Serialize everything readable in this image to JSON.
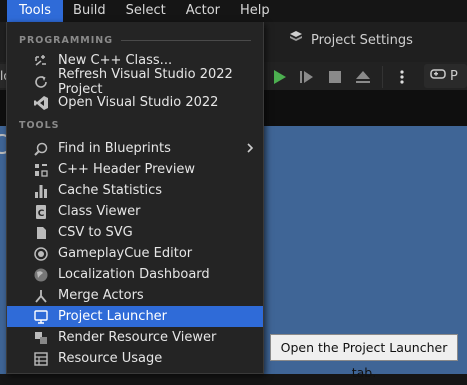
{
  "menubar": {
    "items": [
      {
        "label": "Tools",
        "active": true
      },
      {
        "label": "Build"
      },
      {
        "label": "Select"
      },
      {
        "label": "Actor"
      },
      {
        "label": "Help"
      }
    ]
  },
  "editor": {
    "project_settings_label": "Project Settings",
    "left_fragment": "lo",
    "right_fragment": "P"
  },
  "dropdown": {
    "sections": {
      "programming": "PROGRAMMING",
      "tools": "TOOLS"
    },
    "programming_items": [
      {
        "label": "New C++ Class...",
        "icon": "new-class-icon"
      },
      {
        "label": "Refresh Visual Studio 2022 Project",
        "icon": "refresh-icon"
      },
      {
        "label": "Open Visual Studio 2022",
        "icon": "visual-studio-icon"
      }
    ],
    "tools_items": [
      {
        "label": "Find in Blueprints",
        "icon": "find-icon",
        "submenu": true
      },
      {
        "label": "C++ Header Preview",
        "icon": "header-preview-icon"
      },
      {
        "label": "Cache Statistics",
        "icon": "statistics-icon"
      },
      {
        "label": "Class Viewer",
        "icon": "class-viewer-icon"
      },
      {
        "label": "CSV to SVG",
        "icon": "csv-icon"
      },
      {
        "label": "GameplayCue Editor",
        "icon": "gameplaycue-icon"
      },
      {
        "label": "Localization Dashboard",
        "icon": "localization-icon"
      },
      {
        "label": "Merge Actors",
        "icon": "merge-icon"
      },
      {
        "label": "Project Launcher",
        "icon": "launcher-icon",
        "highlighted": true
      },
      {
        "label": "Render Resource Viewer",
        "icon": "render-resource-icon"
      },
      {
        "label": "Resource Usage",
        "icon": "resource-usage-icon"
      }
    ]
  },
  "tooltip": {
    "text": "Open the Project Launcher tab."
  },
  "colors": {
    "accent": "#2f6bd8",
    "play_green": "#4caf50",
    "viewport_blue": "#3f6596",
    "menu_bg": "#242424"
  }
}
